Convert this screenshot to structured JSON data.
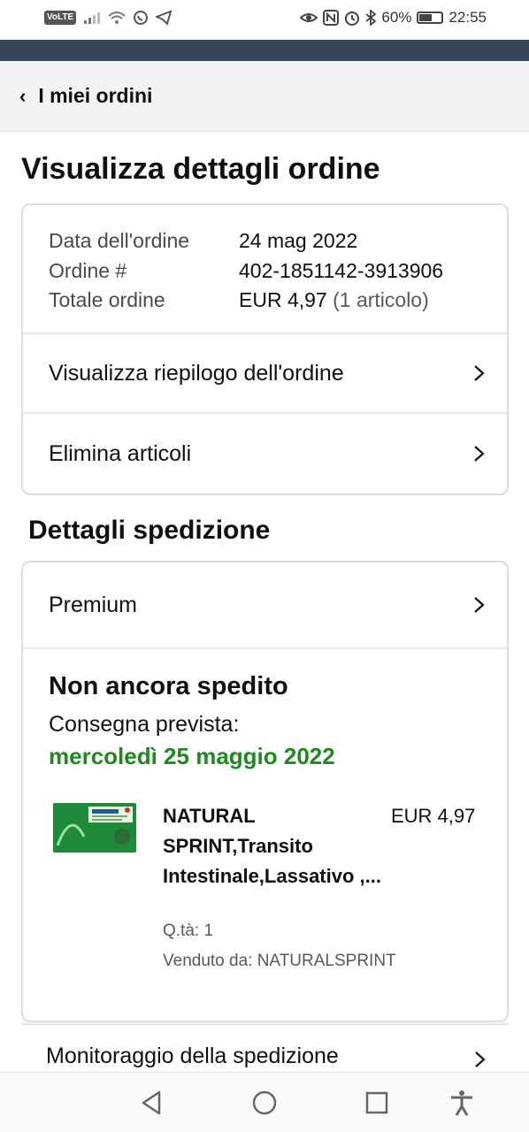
{
  "status_bar": {
    "volte": "VoLTE",
    "battery_percent": "60%",
    "battery_level": 0.6,
    "time": "22:55"
  },
  "nav": {
    "back_label": "I miei ordini"
  },
  "page_title": "Visualizza dettagli ordine",
  "order": {
    "date_label": "Data dell'ordine",
    "date_value": "24 mag 2022",
    "number_label": "Ordine #",
    "number_value": "402-1851142-3913906",
    "total_label": "Totale ordine",
    "total_value": "EUR 4,97",
    "total_items": "(1 articolo)",
    "summary_link": "Visualizza riepilogo dell'ordine",
    "delete_link": "Elimina articoli"
  },
  "shipping": {
    "section_title": "Dettagli spedizione",
    "method": "Premium",
    "status": "Non ancora spedito",
    "delivery_label": "Consegna prevista:",
    "delivery_date": "mercoledì 25 maggio 2022",
    "product": {
      "name": "NATURAL SPRINT,Transito Intestinale,Lassativo ,...",
      "price": "EUR 4,97",
      "quantity": "Q.tà: 1",
      "seller": "Venduto da: NATURALSPRINT"
    },
    "tracking_link": "Monitoraggio della spedizione"
  },
  "colors": {
    "delivery_green": "#1e8a1e",
    "header_dark": "#37475a"
  }
}
